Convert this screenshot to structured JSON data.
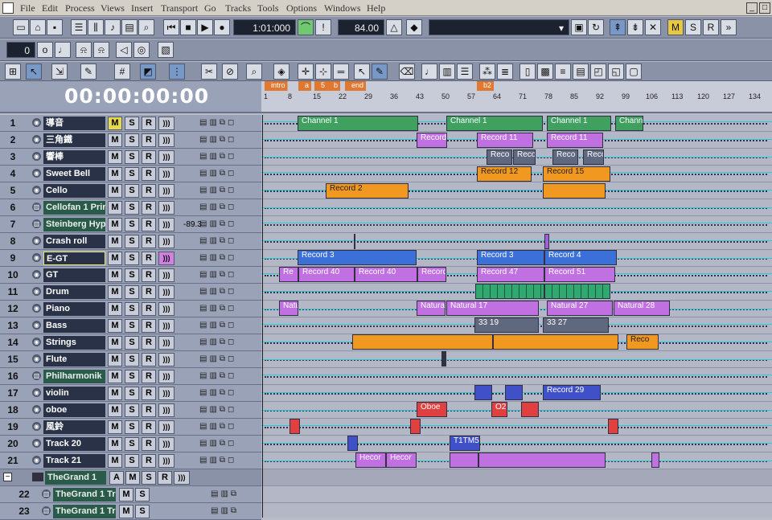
{
  "menu": [
    "File",
    "Edit",
    "Process",
    "Views",
    "Insert",
    "Transport",
    "Go",
    "Tracks",
    "Tools",
    "Options",
    "Windows",
    "Help"
  ],
  "window_controls": [
    "_",
    "□"
  ],
  "transport": {
    "position": "1:01:000",
    "tempo": "84.00",
    "meter_value": "0"
  },
  "mute_solo_buttons": [
    "M",
    "S",
    "R"
  ],
  "clock": "00:00:00:00",
  "ruler": {
    "markers": [
      "intro",
      "a",
      "5",
      "b",
      "end",
      "b2"
    ],
    "ticks": [
      "1",
      "8",
      "15",
      "22",
      "29",
      "36",
      "43",
      "50",
      "57",
      "64",
      "71",
      "78",
      "85",
      "92",
      "99",
      "106",
      "113",
      "120",
      "127",
      "134"
    ]
  },
  "tracks": [
    {
      "num": "1",
      "name": "導音",
      "m": "M",
      "s": "S",
      "r": "R",
      "m_on": true,
      "green": false
    },
    {
      "num": "2",
      "name": "三角鐵",
      "m": "M",
      "s": "S",
      "r": "R"
    },
    {
      "num": "3",
      "name": "響棒",
      "m": "M",
      "s": "S",
      "r": "R"
    },
    {
      "num": "4",
      "name": "Sweet Bell",
      "m": "M",
      "s": "S",
      "r": "R"
    },
    {
      "num": "5",
      "name": "Cello",
      "m": "M",
      "s": "S",
      "r": "R"
    },
    {
      "num": "6",
      "name": "Cellofan 1 Prir",
      "m": "M",
      "s": "S",
      "r": "R",
      "green": true
    },
    {
      "num": "7",
      "name": "Steinberg Hyp",
      "m": "M",
      "s": "S",
      "r": "R",
      "green": true,
      "value": "-89.3"
    },
    {
      "num": "8",
      "name": "Crash roll",
      "m": "M",
      "s": "S",
      "r": "R"
    },
    {
      "num": "9",
      "name": "E-GT",
      "m": "M",
      "s": "S",
      "r": "R",
      "sel": true
    },
    {
      "num": "10",
      "name": "GT",
      "m": "M",
      "s": "S",
      "r": "R"
    },
    {
      "num": "11",
      "name": "Drum",
      "m": "M",
      "s": "S",
      "r": "R"
    },
    {
      "num": "12",
      "name": "Piano",
      "m": "M",
      "s": "S",
      "r": "R"
    },
    {
      "num": "13",
      "name": "Bass",
      "m": "M",
      "s": "S",
      "r": "R"
    },
    {
      "num": "14",
      "name": "Strings",
      "m": "M",
      "s": "S",
      "r": "R"
    },
    {
      "num": "15",
      "name": "Flute",
      "m": "M",
      "s": "S",
      "r": "R"
    },
    {
      "num": "16",
      "name": "Philharmonik",
      "m": "M",
      "s": "S",
      "r": "R",
      "green": true
    },
    {
      "num": "17",
      "name": "violin",
      "m": "M",
      "s": "S",
      "r": "R"
    },
    {
      "num": "18",
      "name": "oboe",
      "m": "M",
      "s": "S",
      "r": "R"
    },
    {
      "num": "19",
      "name": "風鈴",
      "m": "M",
      "s": "S",
      "r": "R"
    },
    {
      "num": "20",
      "name": "Track 20",
      "m": "M",
      "s": "S",
      "r": "R"
    },
    {
      "num": "21",
      "name": "Track 21",
      "m": "M",
      "s": "S",
      "r": "R"
    }
  ],
  "folder": {
    "name": "TheGrand 1",
    "a": "A",
    "m": "M",
    "s": "S",
    "r": "R"
  },
  "subtracks": [
    {
      "num": "22",
      "name": "TheGrand 1 Tr",
      "m": "M",
      "s": "S"
    },
    {
      "num": "23",
      "name": "TheGrand 1 Tr",
      "m": "M",
      "s": "S"
    }
  ],
  "clips": {
    "channel1a": "Channel 1",
    "channel1b": "Channel 1",
    "channel1c": "Channel 1",
    "channel1d": "Chann",
    "rec11a": "Record",
    "rec11b": "Record 11",
    "rec11c": "Record 11",
    "rec_a": "Reco",
    "rec_b": "Reco",
    "rec_c": "Reco",
    "rec_d": "Reco",
    "rec12": "Record 12",
    "rec15": "Record 15",
    "rec2": "Record 2",
    "rec3a": "Record 3",
    "rec3b": "Record 3",
    "rec3c": "Record 4",
    "rec40a": "Re",
    "rec40b": "Record 40",
    "rec40c": "Record 40",
    "rec40d": "Record",
    "rec47": "Record 47",
    "rec51": "Record 51",
    "nat": "Natu",
    "nat17a": "Natura",
    "nat17b": "Natural 17",
    "nat27": "Natural 27",
    "nat28": "Natural 28",
    "bass19": "33 19",
    "bass27": "33 27",
    "strings_end": "Reco",
    "rec29": "Record 29",
    "oboe": "Oboe",
    "oboe2": "O2",
    "t21a": "Hecor",
    "t21b": "Hecor",
    "t20": "T1TM5"
  }
}
